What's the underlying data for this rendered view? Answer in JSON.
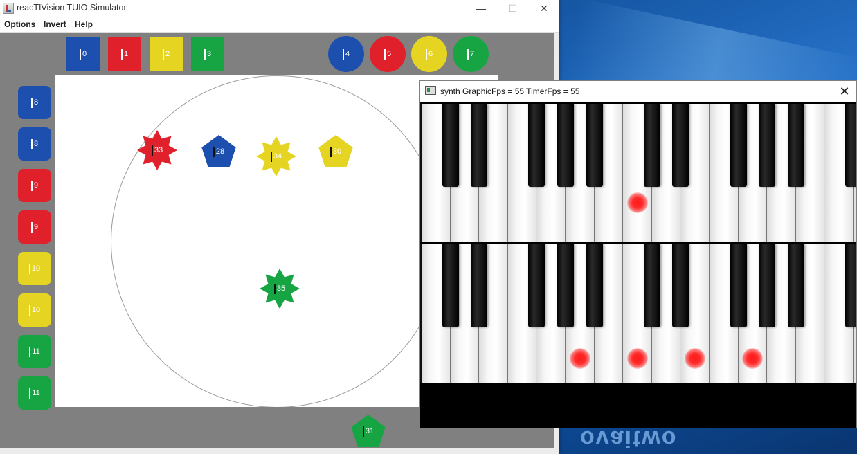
{
  "desktop": {
    "logo_text": "ovaitwo"
  },
  "simulator": {
    "title": "reacTIVision TUIO Simulator",
    "window_controls": {
      "minimize": "—",
      "maximize": "☐",
      "close": "✕"
    },
    "menu": [
      "Options",
      "Invert",
      "Help"
    ],
    "colors": {
      "blue": "#1c4fae",
      "red": "#e0212b",
      "yellow": "#e6d422",
      "green": "#17a544",
      "canvas": "#808080"
    },
    "objects": [
      {
        "id": "0",
        "shape": "square",
        "color": "blue"
      },
      {
        "id": "1",
        "shape": "square",
        "color": "red"
      },
      {
        "id": "2",
        "shape": "square",
        "color": "yellow"
      },
      {
        "id": "3",
        "shape": "square",
        "color": "green"
      },
      {
        "id": "4",
        "shape": "round",
        "color": "blue"
      },
      {
        "id": "5",
        "shape": "round",
        "color": "red"
      },
      {
        "id": "6",
        "shape": "round",
        "color": "yellow"
      },
      {
        "id": "7",
        "shape": "round",
        "color": "green"
      },
      {
        "id": "8",
        "shape": "rounded-square",
        "color": "blue"
      },
      {
        "id": "8",
        "shape": "rounded-square",
        "color": "blue"
      },
      {
        "id": "9",
        "shape": "rounded-square",
        "color": "red"
      },
      {
        "id": "9",
        "shape": "rounded-square",
        "color": "red"
      },
      {
        "id": "10",
        "shape": "rounded-square",
        "color": "yellow"
      },
      {
        "id": "10",
        "shape": "rounded-square",
        "color": "yellow"
      },
      {
        "id": "11",
        "shape": "rounded-square",
        "color": "green"
      },
      {
        "id": "11",
        "shape": "rounded-square",
        "color": "green"
      },
      {
        "id": "33",
        "shape": "star",
        "color": "red"
      },
      {
        "id": "28",
        "shape": "pentagon",
        "color": "blue"
      },
      {
        "id": "34",
        "shape": "star",
        "color": "yellow"
      },
      {
        "id": "30",
        "shape": "pentagon",
        "color": "yellow"
      },
      {
        "id": "35",
        "shape": "star",
        "color": "green"
      },
      {
        "id": "31",
        "shape": "pentagon",
        "color": "green"
      }
    ]
  },
  "synth": {
    "title": "synth GraphicFps = 55   TimerFps = 55",
    "close": "✕",
    "rows": [
      {
        "active_white_keys": [
          7
        ]
      },
      {
        "active_white_keys": [
          5,
          7,
          9,
          11
        ]
      }
    ]
  }
}
